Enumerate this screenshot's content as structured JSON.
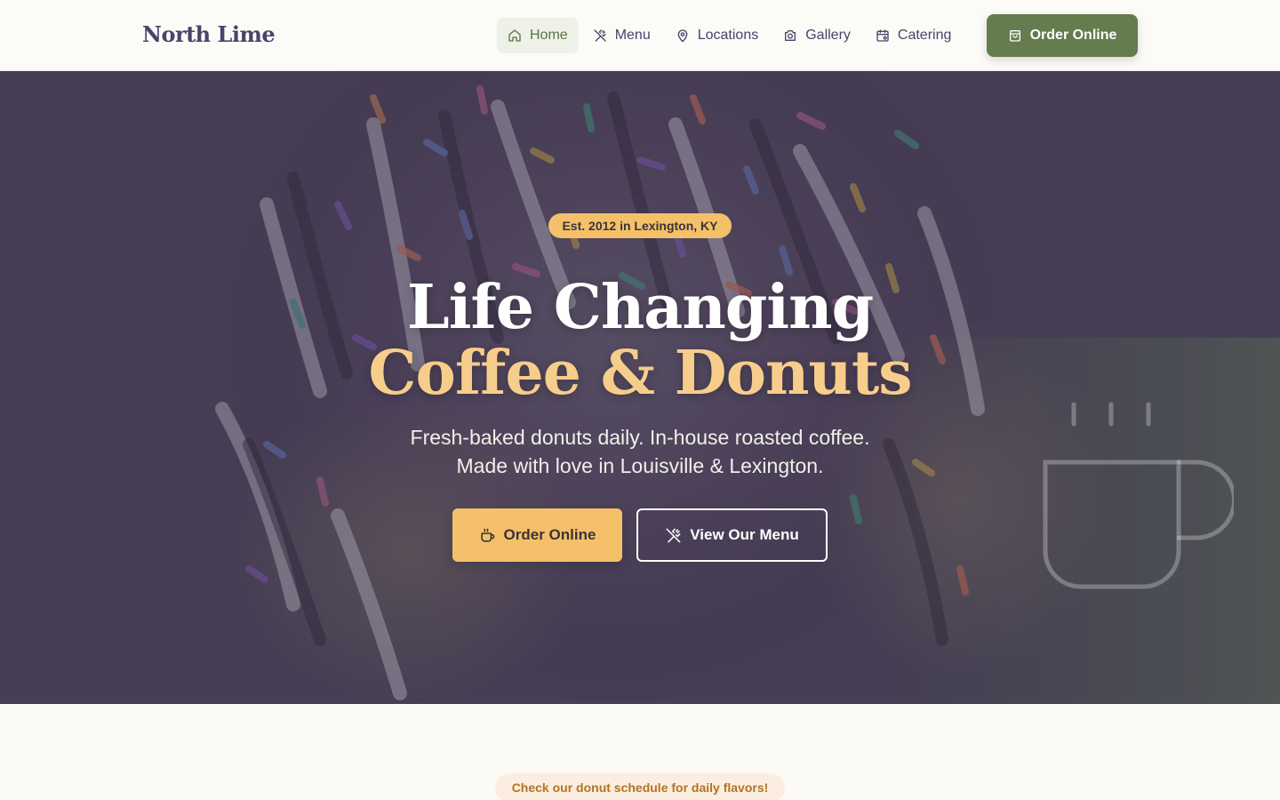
{
  "brand": {
    "name": "North Lime"
  },
  "nav": {
    "items": [
      {
        "label": "Home",
        "icon": "home-icon",
        "active": true
      },
      {
        "label": "Menu",
        "icon": "utensils-icon",
        "active": false
      },
      {
        "label": "Locations",
        "icon": "map-pin-icon",
        "active": false
      },
      {
        "label": "Gallery",
        "icon": "camera-icon",
        "active": false
      },
      {
        "label": "Catering",
        "icon": "calendar-icon",
        "active": false
      }
    ],
    "cta": {
      "label": "Order Online",
      "icon": "shopping-bag-icon"
    }
  },
  "hero": {
    "badge": "Est. 2012 in Lexington, KY",
    "title_line1": "Life Changing",
    "title_line2": "Coffee & Donuts",
    "subtitle_line1": "Fresh-baked donuts daily. In-house roasted coffee.",
    "subtitle_line2": "Made with love in Louisville & Lexington.",
    "primary_button": {
      "label": "Order Online",
      "icon": "coffee-cup-icon"
    },
    "secondary_button": {
      "label": "View Our Menu",
      "icon": "utensils-icon"
    }
  },
  "schedule_note": "Check our donut schedule for daily flavors!",
  "colors": {
    "accent": "#647c4e",
    "gold": "#f4c06a",
    "title_gold": "#f7cd8c",
    "navy_text": "#45466a"
  }
}
